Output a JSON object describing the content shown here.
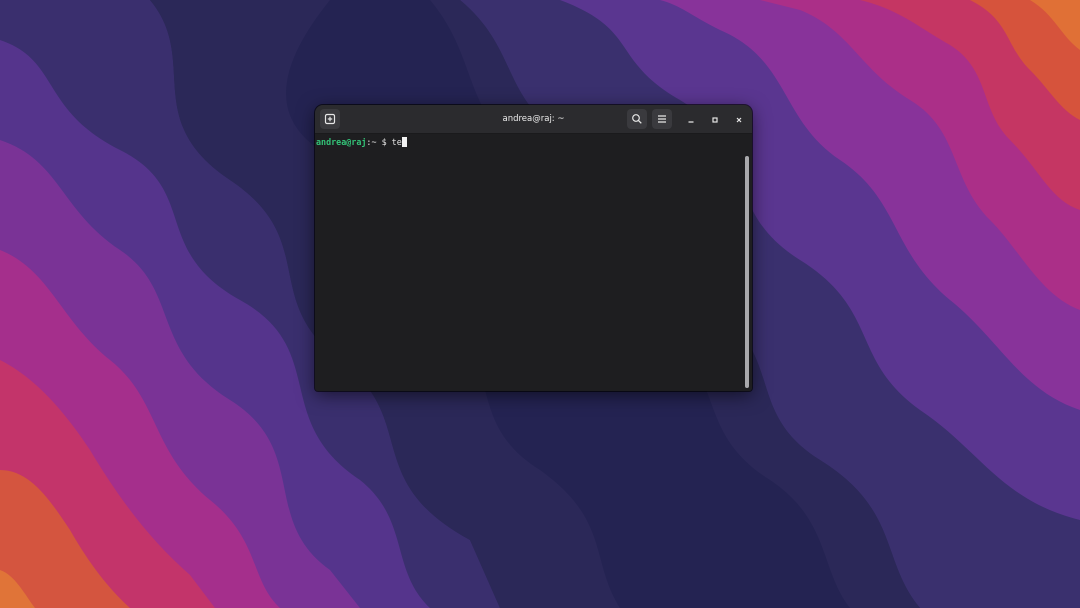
{
  "desktop": {
    "wallpaper_colors": [
      "#2c2a5c",
      "#3b3070",
      "#5a3590",
      "#8a3198",
      "#b02d86",
      "#cc3c5c",
      "#d85a36"
    ]
  },
  "terminal": {
    "title": "andrea@raj: ~",
    "prompt_user": "andrea@raj",
    "prompt_path": ":~",
    "prompt_symbol": "$",
    "input_text": "te",
    "colors": {
      "prompt_user": "#33c277",
      "background": "#1e1e20",
      "titlebar": "#2b2b2e"
    },
    "icons": {
      "new_tab": "new-tab-icon",
      "search": "search-icon",
      "menu": "hamburger-menu-icon",
      "minimize": "minimize-icon",
      "maximize": "maximize-icon",
      "close": "close-icon"
    }
  }
}
